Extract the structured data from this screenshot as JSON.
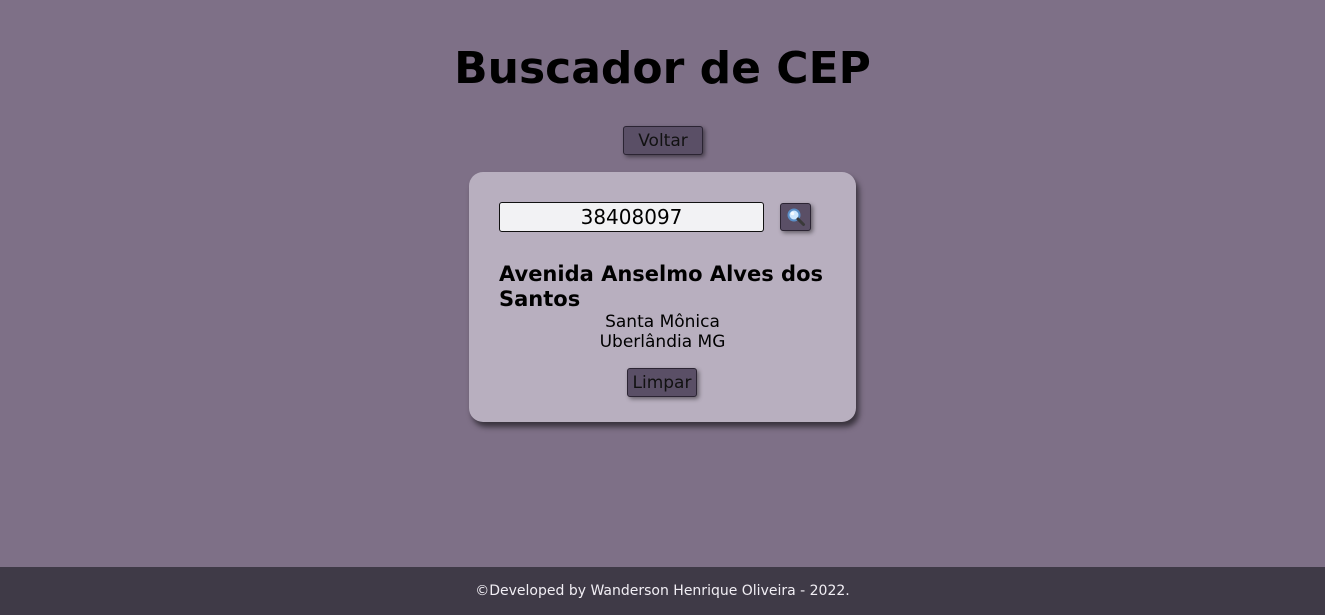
{
  "header": {
    "title": "Buscador de CEP"
  },
  "nav": {
    "back_label": "Voltar"
  },
  "search": {
    "cep_value": "38408097",
    "button_icon": "magnifier-icon"
  },
  "result": {
    "street": "Avenida Anselmo Alves dos Santos",
    "neighborhood": "Santa Mônica",
    "city_state": "Uberlândia MG",
    "clear_label": "Limpar"
  },
  "footer": {
    "credit": "©Developed by Wanderson Henrique Oliveira - 2022."
  },
  "colors": {
    "background": "#7e7087",
    "card": "#b8afbf",
    "button": "#5a4f66",
    "footer": "#3f3a47"
  }
}
